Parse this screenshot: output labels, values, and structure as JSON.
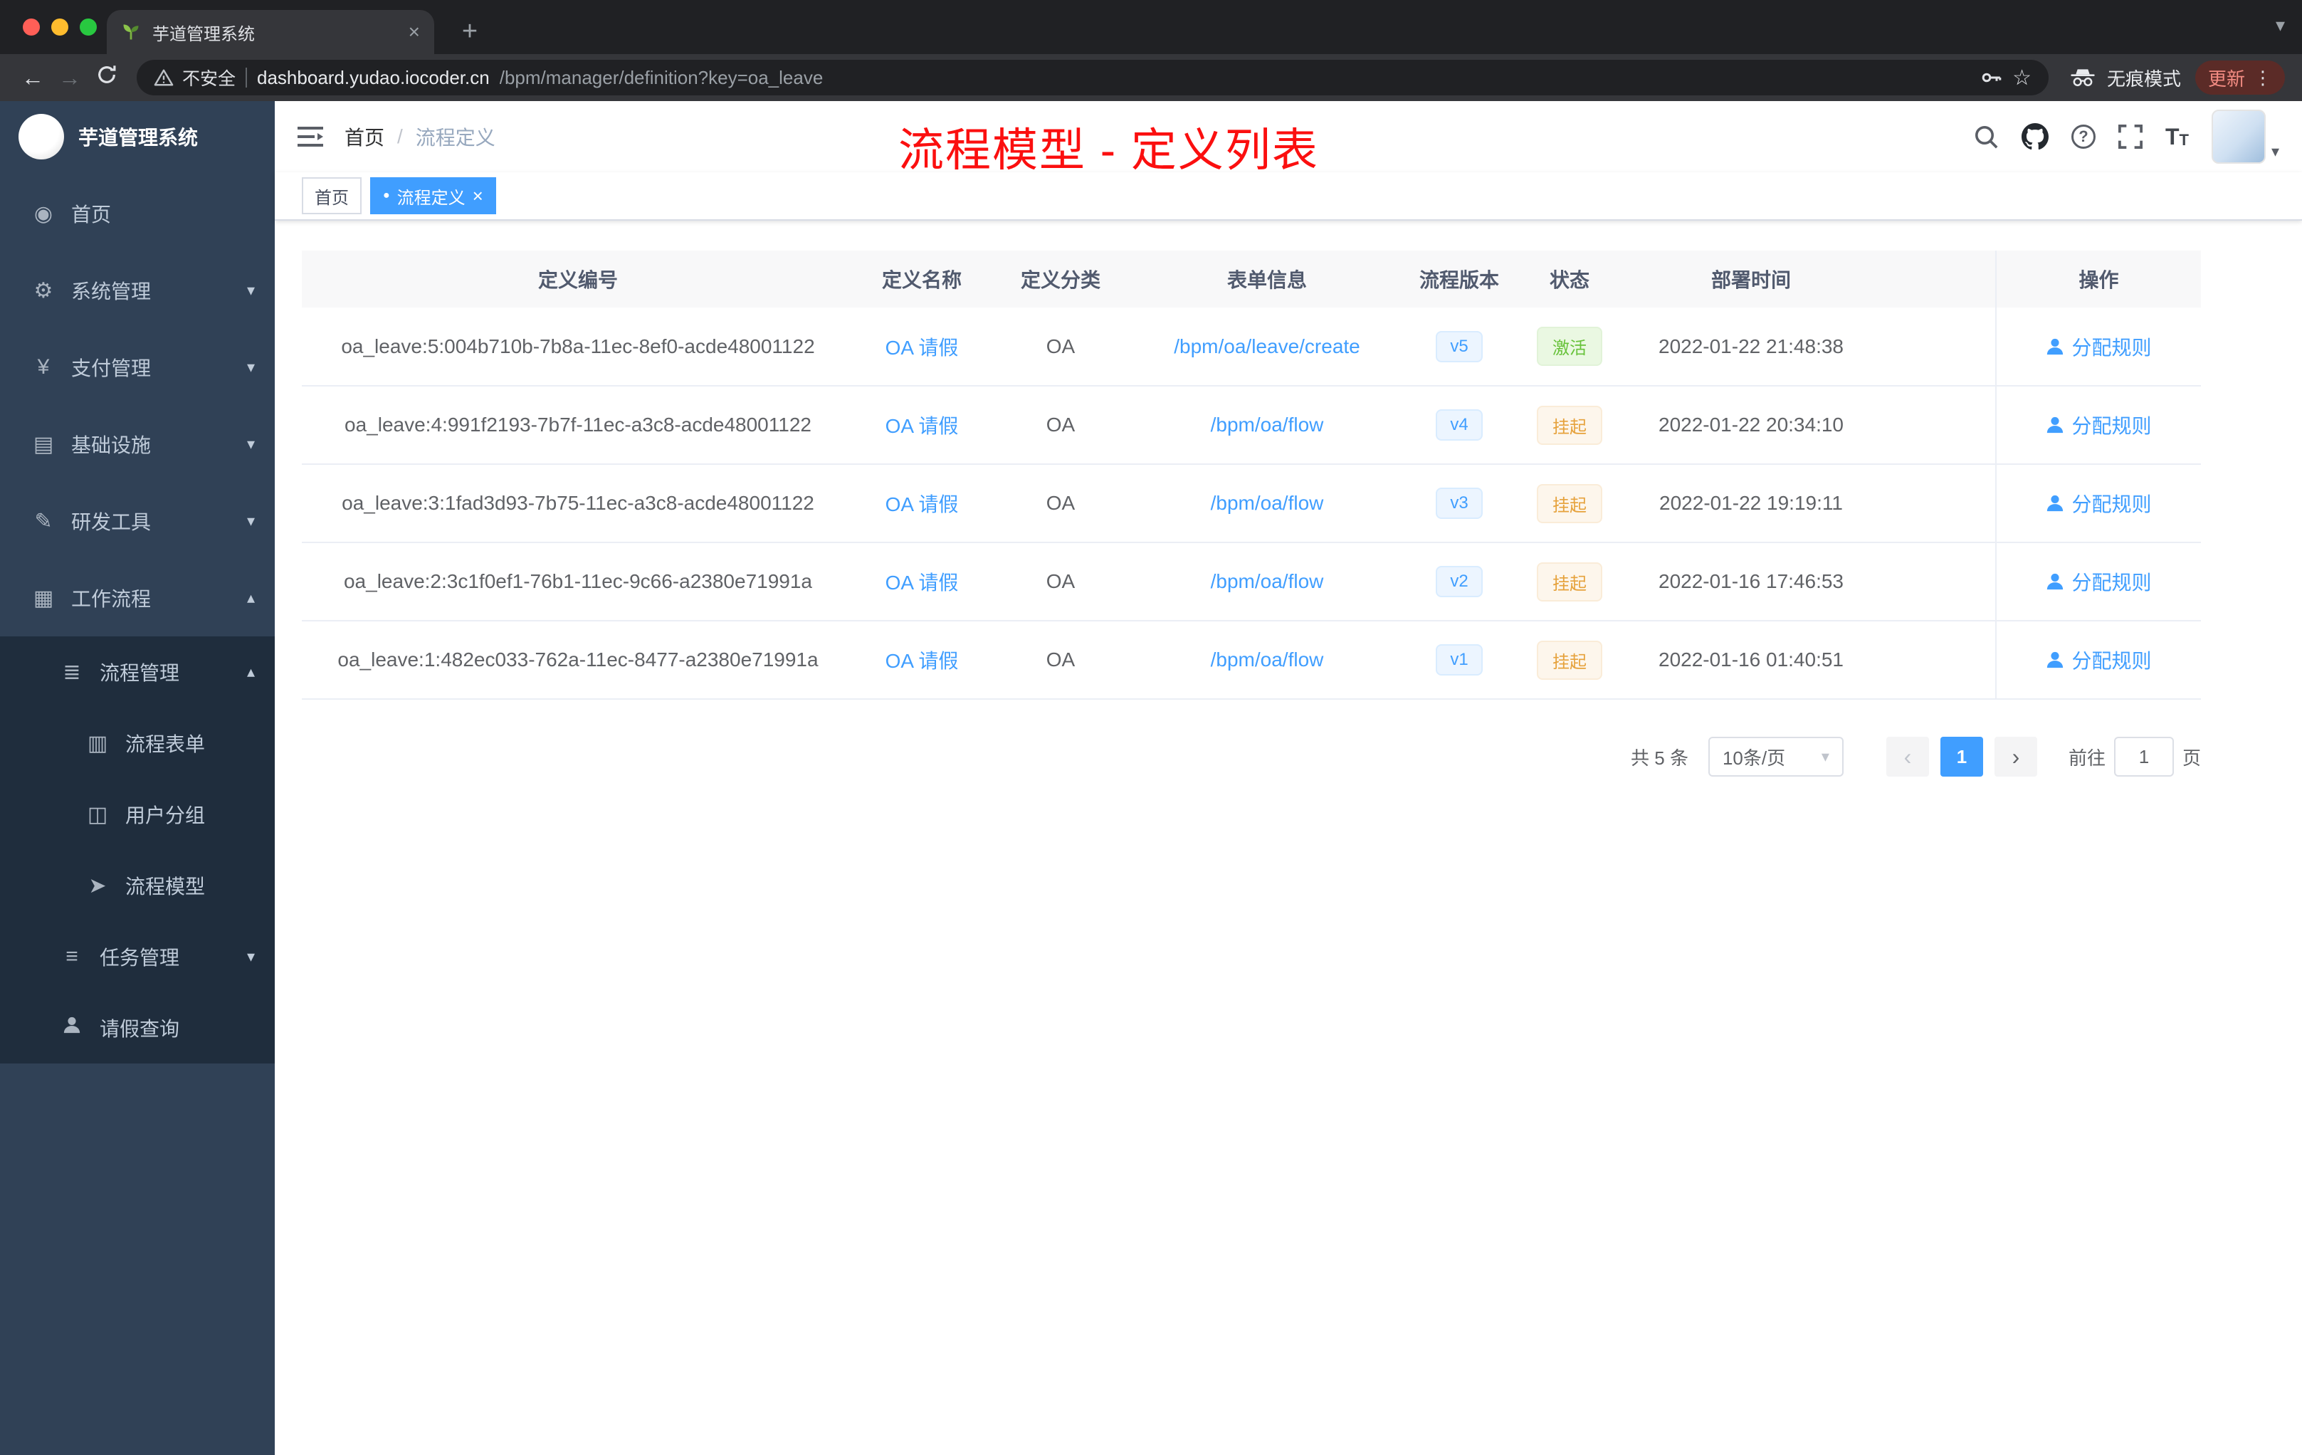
{
  "colors": {
    "accent": "#409eff",
    "success": "#67c23a",
    "warning": "#e6a23c",
    "annotation_red": "#fb0f0f",
    "sidebar_bg": "#304156",
    "submenu_bg": "#1f2d3d"
  },
  "browser": {
    "tab_title": "芋道管理系统",
    "tab_close_glyph": "×",
    "new_tab_glyph": "+",
    "tab_caret_glyph": "▾",
    "back_glyph": "←",
    "forward_glyph": "→",
    "security_label": "不安全",
    "url_domain": "dashboard.yudao.iocoder.cn",
    "url_path": "/bpm/manager/definition?key=oa_leave",
    "star_glyph": "☆",
    "incognito_label": "无痕模式",
    "update_label": "更新",
    "menu_dots_glyph": "⋮"
  },
  "sidebar": {
    "app_title": "芋道管理系统",
    "items": [
      {
        "label": "首页",
        "icon": "◉",
        "icon_name": "dashboard-icon"
      },
      {
        "label": "系统管理",
        "icon": "⚙",
        "icon_name": "gear-icon",
        "chevron": "▾"
      },
      {
        "label": "支付管理",
        "icon": "¥",
        "icon_name": "yen-icon",
        "chevron": "▾"
      },
      {
        "label": "基础设施",
        "icon": "▤",
        "icon_name": "infrastructure-icon",
        "chevron": "▾"
      },
      {
        "label": "研发工具",
        "icon": "✎",
        "icon_name": "dev-tools-icon",
        "chevron": "▾"
      },
      {
        "label": "工作流程",
        "icon": "▦",
        "icon_name": "workflow-icon",
        "chevron": "▴"
      },
      {
        "label": "流程管理",
        "icon": "≣",
        "icon_name": "process-management-icon",
        "chevron": "▴"
      },
      {
        "label": "流程表单",
        "icon": "▥",
        "icon_name": "process-form-icon"
      },
      {
        "label": "用户分组",
        "icon": "◫",
        "icon_name": "user-group-icon"
      },
      {
        "label": "流程模型",
        "icon": "➤",
        "icon_name": "process-model-icon"
      },
      {
        "label": "任务管理",
        "icon": "≡",
        "icon_name": "task-management-icon",
        "chevron": "▾"
      },
      {
        "label": "请假查询",
        "icon": "",
        "icon_name": "user-icon"
      }
    ]
  },
  "navbar": {
    "breadcrumb": {
      "home": "首页",
      "separator": "/",
      "current": "流程定义"
    },
    "annotation": "流程模型 - 定义列表",
    "help_glyph": "?",
    "fontsize_glyph": "T",
    "avatar_caret_glyph": "▾"
  },
  "tags": {
    "home": "首页",
    "active": "流程定义",
    "dot": "●",
    "close": "×"
  },
  "table": {
    "columns": [
      "定义编号",
      "定义名称",
      "定义分类",
      "表单信息",
      "流程版本",
      "状态",
      "部署时间",
      "操作"
    ],
    "rows": [
      {
        "id": "oa_leave:5:004b710b-7b8a-11ec-8ef0-acde48001122",
        "name": "OA 请假",
        "category": "OA",
        "form": "/bpm/oa/leave/create",
        "version": "v5",
        "status": "激活",
        "time": "2022-01-22 21:48:38",
        "action": "分配规则"
      },
      {
        "id": "oa_leave:4:991f2193-7b7f-11ec-a3c8-acde48001122",
        "name": "OA 请假",
        "category": "OA",
        "form": "/bpm/oa/flow",
        "version": "v4",
        "status": "挂起",
        "time": "2022-01-22 20:34:10",
        "action": "分配规则"
      },
      {
        "id": "oa_leave:3:1fad3d93-7b75-11ec-a3c8-acde48001122",
        "name": "OA 请假",
        "category": "OA",
        "form": "/bpm/oa/flow",
        "version": "v3",
        "status": "挂起",
        "time": "2022-01-22 19:19:11",
        "action": "分配规则"
      },
      {
        "id": "oa_leave:2:3c1f0ef1-76b1-11ec-9c66-a2380e71991a",
        "name": "OA 请假",
        "category": "OA",
        "form": "/bpm/oa/flow",
        "version": "v2",
        "status": "挂起",
        "time": "2022-01-16 17:46:53",
        "action": "分配规则"
      },
      {
        "id": "oa_leave:1:482ec033-762a-11ec-8477-a2380e71991a",
        "name": "OA 请假",
        "category": "OA",
        "form": "/bpm/oa/flow",
        "version": "v1",
        "status": "挂起",
        "time": "2022-01-16 01:40:51",
        "action": "分配规则"
      }
    ]
  },
  "pagination": {
    "total": "共 5 条",
    "page_size": "10条/页",
    "size_caret": "▾",
    "prev": "‹",
    "current": "1",
    "next": "›",
    "goto_label": "前往",
    "goto_value": "1",
    "goto_unit": "页"
  }
}
